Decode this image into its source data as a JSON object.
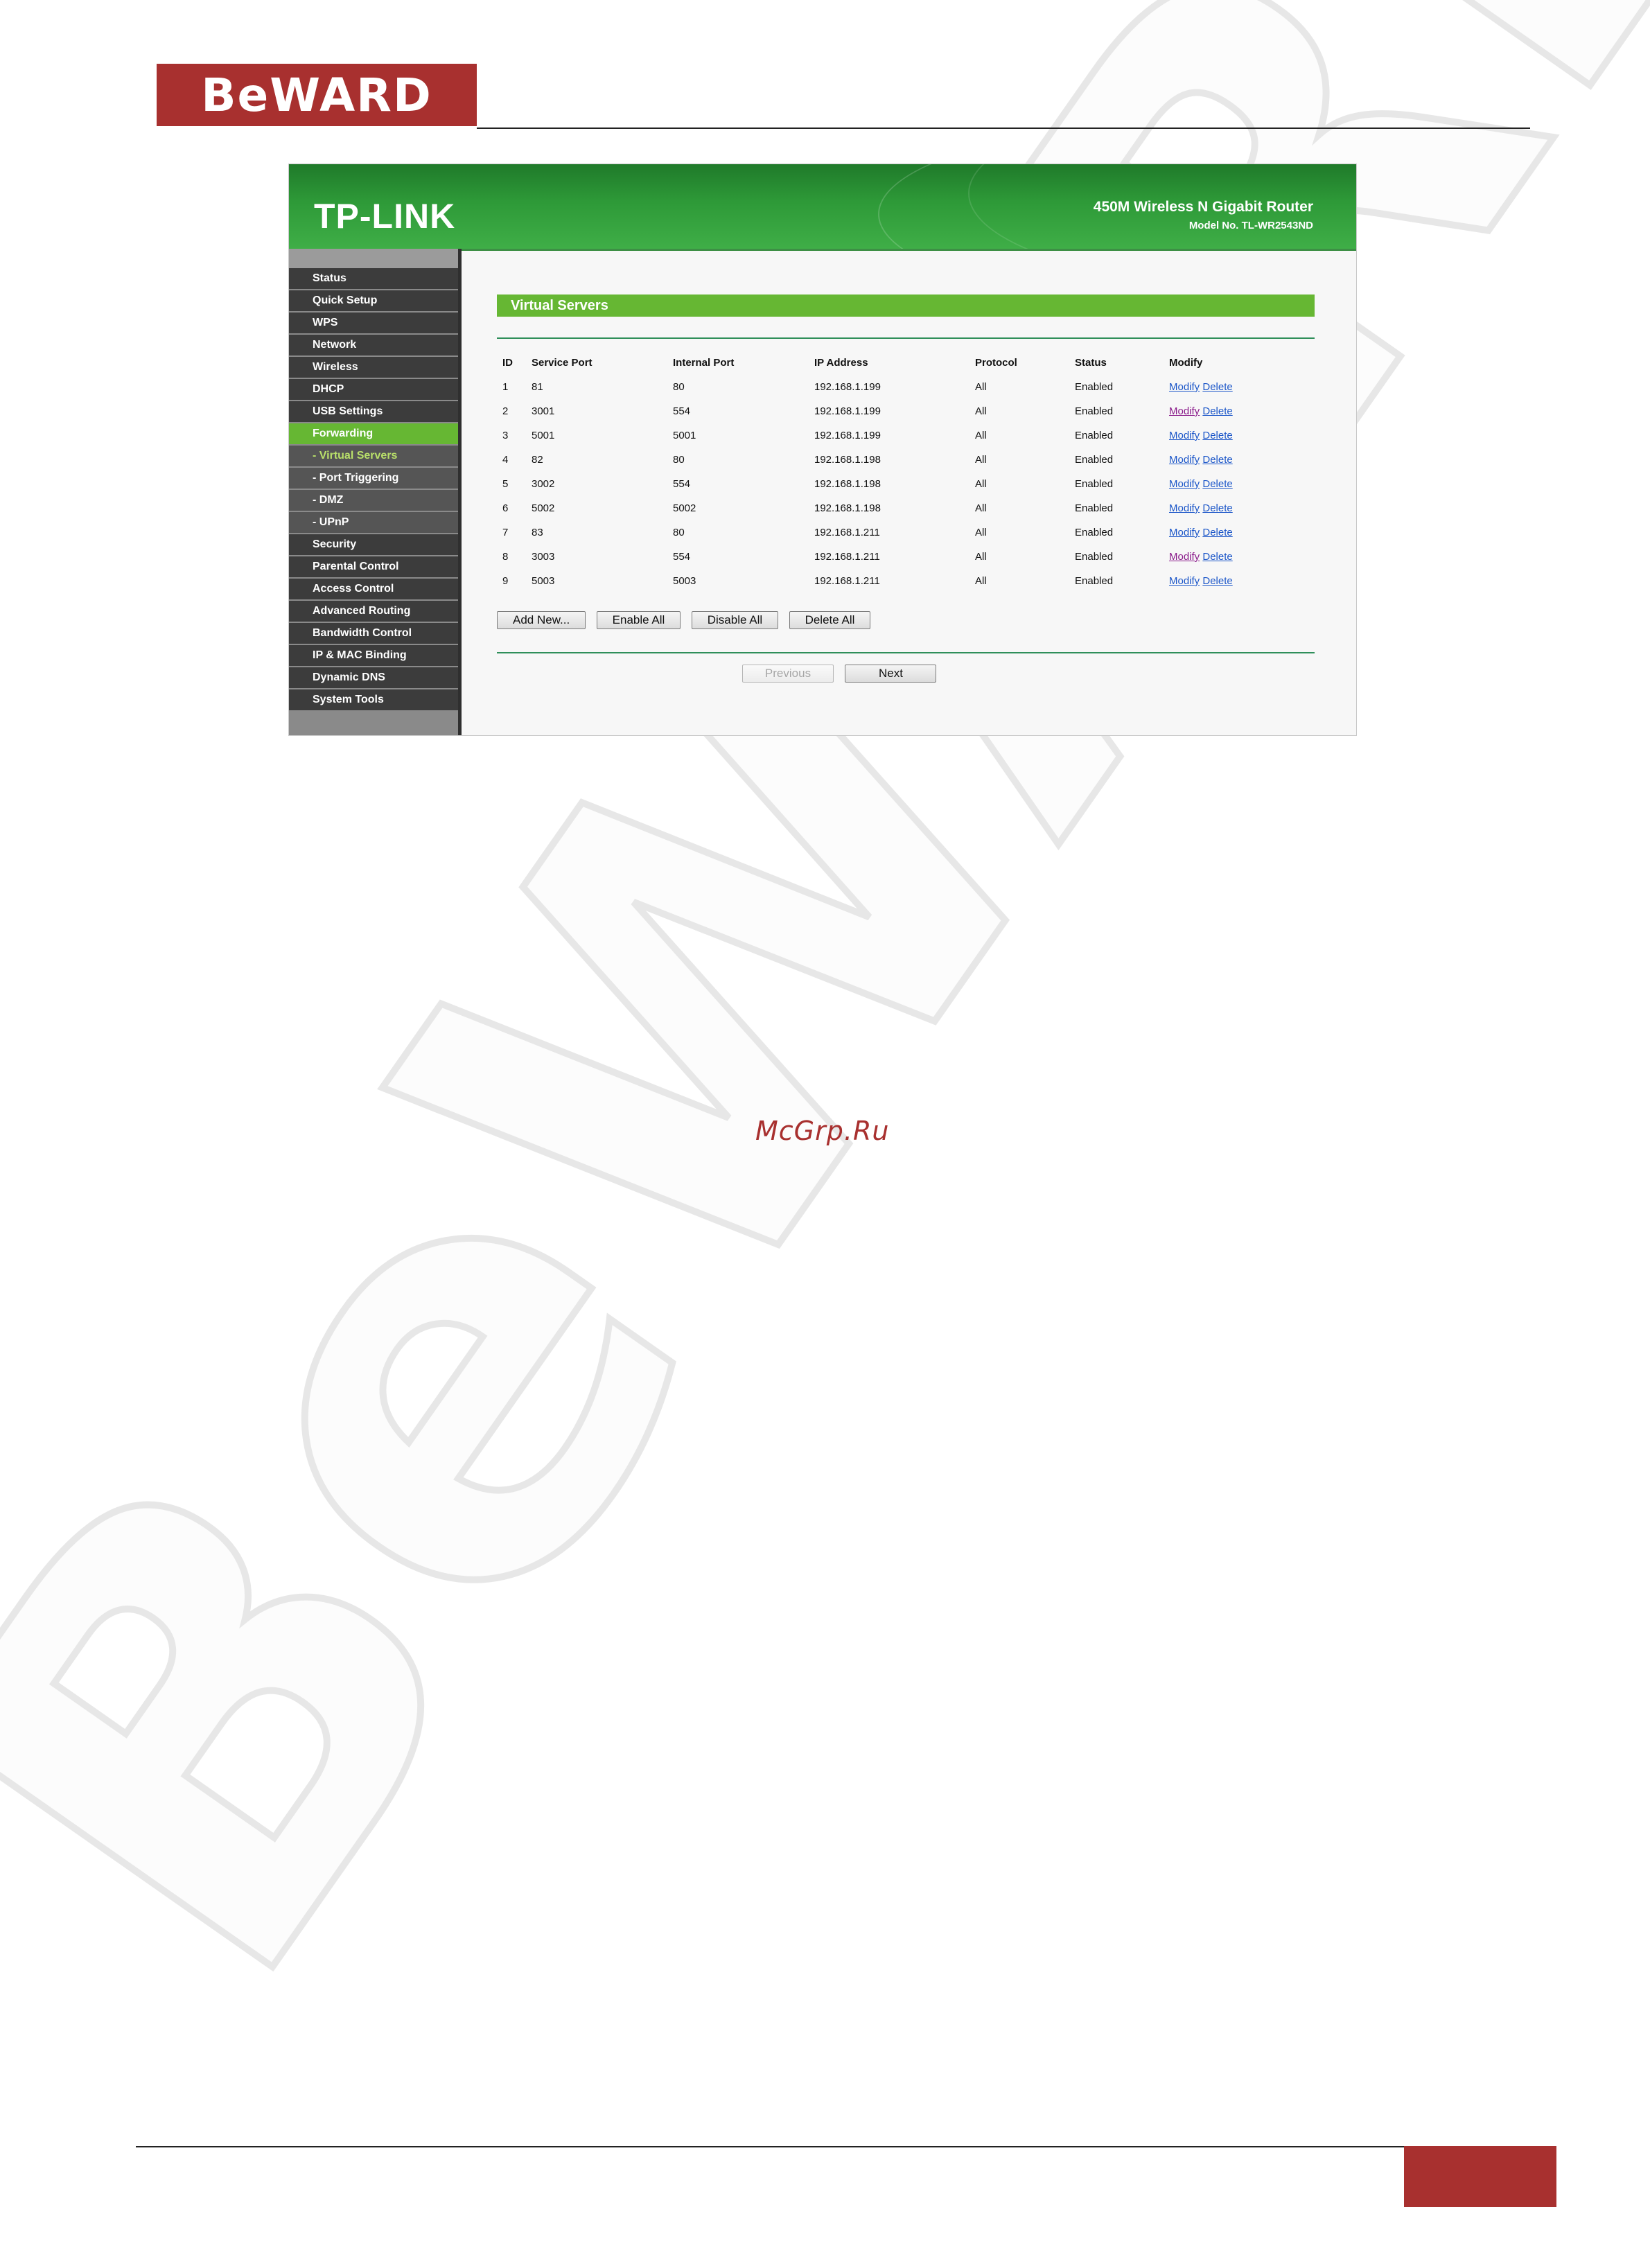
{
  "document": {
    "brand_logo_text": "BeWARD",
    "site_credit": "McGrp.Ru",
    "watermark_text": "BeWARD",
    "colors": {
      "brand_red": "#a8302f",
      "router_green": "#66b733"
    }
  },
  "router": {
    "logo": "TP-LINK",
    "product_name": "450M Wireless N Gigabit Router",
    "model_no": "Model No. TL-WR2543ND",
    "sidebar": {
      "items": [
        {
          "label": "Status",
          "state": "normal"
        },
        {
          "label": "Quick Setup",
          "state": "normal"
        },
        {
          "label": "WPS",
          "state": "normal"
        },
        {
          "label": "Network",
          "state": "normal"
        },
        {
          "label": "Wireless",
          "state": "normal"
        },
        {
          "label": "DHCP",
          "state": "normal"
        },
        {
          "label": "USB Settings",
          "state": "normal"
        },
        {
          "label": "Forwarding",
          "state": "active"
        },
        {
          "label": "- Virtual Servers",
          "state": "sub-active"
        },
        {
          "label": "- Port Triggering",
          "state": "sub"
        },
        {
          "label": "- DMZ",
          "state": "sub"
        },
        {
          "label": "- UPnP",
          "state": "sub"
        },
        {
          "label": "Security",
          "state": "normal"
        },
        {
          "label": "Parental Control",
          "state": "normal"
        },
        {
          "label": "Access Control",
          "state": "normal"
        },
        {
          "label": "Advanced Routing",
          "state": "normal"
        },
        {
          "label": "Bandwidth Control",
          "state": "normal"
        },
        {
          "label": "IP & MAC Binding",
          "state": "normal"
        },
        {
          "label": "Dynamic DNS",
          "state": "normal"
        },
        {
          "label": "System Tools",
          "state": "normal"
        }
      ]
    },
    "section_title": "Virtual Servers",
    "table": {
      "headers": [
        "ID",
        "Service Port",
        "Internal Port",
        "IP Address",
        "Protocol",
        "Status",
        "Modify"
      ],
      "rows": [
        {
          "id": "1",
          "service_port": "81",
          "internal_port": "80",
          "ip": "192.168.1.199",
          "protocol": "All",
          "status": "Enabled",
          "modify": "Modify",
          "delete": "Delete",
          "modify_visited": false
        },
        {
          "id": "2",
          "service_port": "3001",
          "internal_port": "554",
          "ip": "192.168.1.199",
          "protocol": "All",
          "status": "Enabled",
          "modify": "Modify",
          "delete": "Delete",
          "modify_visited": true
        },
        {
          "id": "3",
          "service_port": "5001",
          "internal_port": "5001",
          "ip": "192.168.1.199",
          "protocol": "All",
          "status": "Enabled",
          "modify": "Modify",
          "delete": "Delete",
          "modify_visited": false
        },
        {
          "id": "4",
          "service_port": "82",
          "internal_port": "80",
          "ip": "192.168.1.198",
          "protocol": "All",
          "status": "Enabled",
          "modify": "Modify",
          "delete": "Delete",
          "modify_visited": false
        },
        {
          "id": "5",
          "service_port": "3002",
          "internal_port": "554",
          "ip": "192.168.1.198",
          "protocol": "All",
          "status": "Enabled",
          "modify": "Modify",
          "delete": "Delete",
          "modify_visited": false
        },
        {
          "id": "6",
          "service_port": "5002",
          "internal_port": "5002",
          "ip": "192.168.1.198",
          "protocol": "All",
          "status": "Enabled",
          "modify": "Modify",
          "delete": "Delete",
          "modify_visited": false
        },
        {
          "id": "7",
          "service_port": "83",
          "internal_port": "80",
          "ip": "192.168.1.211",
          "protocol": "All",
          "status": "Enabled",
          "modify": "Modify",
          "delete": "Delete",
          "modify_visited": false
        },
        {
          "id": "8",
          "service_port": "3003",
          "internal_port": "554",
          "ip": "192.168.1.211",
          "protocol": "All",
          "status": "Enabled",
          "modify": "Modify",
          "delete": "Delete",
          "modify_visited": true
        },
        {
          "id": "9",
          "service_port": "5003",
          "internal_port": "5003",
          "ip": "192.168.1.211",
          "protocol": "All",
          "status": "Enabled",
          "modify": "Modify",
          "delete": "Delete",
          "modify_visited": false
        }
      ]
    },
    "buttons": {
      "add_new": "Add New...",
      "enable_all": "Enable All",
      "disable_all": "Disable All",
      "delete_all": "Delete All",
      "previous": "Previous",
      "next": "Next"
    }
  }
}
